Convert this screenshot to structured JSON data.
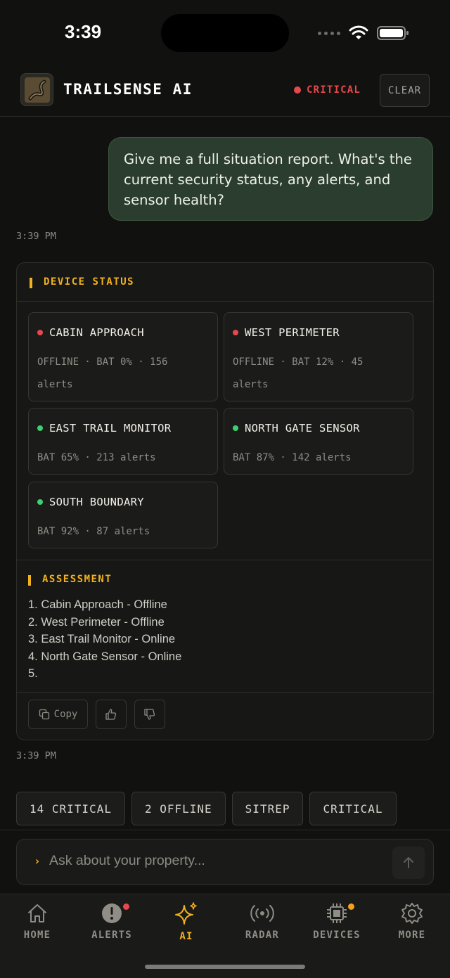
{
  "status_bar": {
    "time": "3:39"
  },
  "header": {
    "title": "TRAILSENSE AI",
    "status": "CRITICAL",
    "clear_label": "CLEAR"
  },
  "user_message": {
    "text": "Give me a full situation report. What's the current security status, any alerts, and sensor health?",
    "time": "3:39 PM"
  },
  "ai_response": {
    "device_status_title": "DEVICE STATUS",
    "devices": [
      {
        "name": "CABIN APPROACH",
        "status": "offline",
        "meta": "OFFLINE · BAT 0% · 156 alerts"
      },
      {
        "name": "WEST PERIMETER",
        "status": "offline",
        "meta": "OFFLINE · BAT 12% · 45 alerts"
      },
      {
        "name": "EAST TRAIL MONITOR",
        "status": "online",
        "meta": "BAT 65% · 213 alerts"
      },
      {
        "name": "NORTH GATE SENSOR",
        "status": "online",
        "meta": "BAT 87% · 142 alerts"
      },
      {
        "name": "SOUTH BOUNDARY",
        "status": "online",
        "meta": "BAT 92% · 87 alerts"
      }
    ],
    "assessment_title": "ASSESSMENT",
    "assessment": [
      "1. Cabin Approach - Offline",
      "2. West Perimeter - Offline",
      "3. East Trail Monitor - Online",
      "4. North Gate Sensor - Online",
      "5."
    ],
    "copy_label": "Copy",
    "time": "3:39 PM"
  },
  "quick_chips": [
    "14 CRITICAL",
    "2 OFFLINE",
    "SITREP",
    "CRITICAL"
  ],
  "input": {
    "placeholder": "Ask about your property..."
  },
  "tabs": [
    {
      "label": "HOME",
      "icon": "home-icon"
    },
    {
      "label": "ALERTS",
      "icon": "alert-icon",
      "badge": "#e5484d"
    },
    {
      "label": "AI",
      "icon": "sparkle-icon",
      "active": true
    },
    {
      "label": "RADAR",
      "icon": "radar-icon"
    },
    {
      "label": "DEVICES",
      "icon": "chip-icon",
      "badge": "#f2a31d"
    },
    {
      "label": "MORE",
      "icon": "gear-icon"
    }
  ],
  "colors": {
    "accent": "#f2b11d",
    "critical": "#e5484d",
    "online": "#3ecf6e",
    "user_bubble": "#2b3d2f"
  }
}
